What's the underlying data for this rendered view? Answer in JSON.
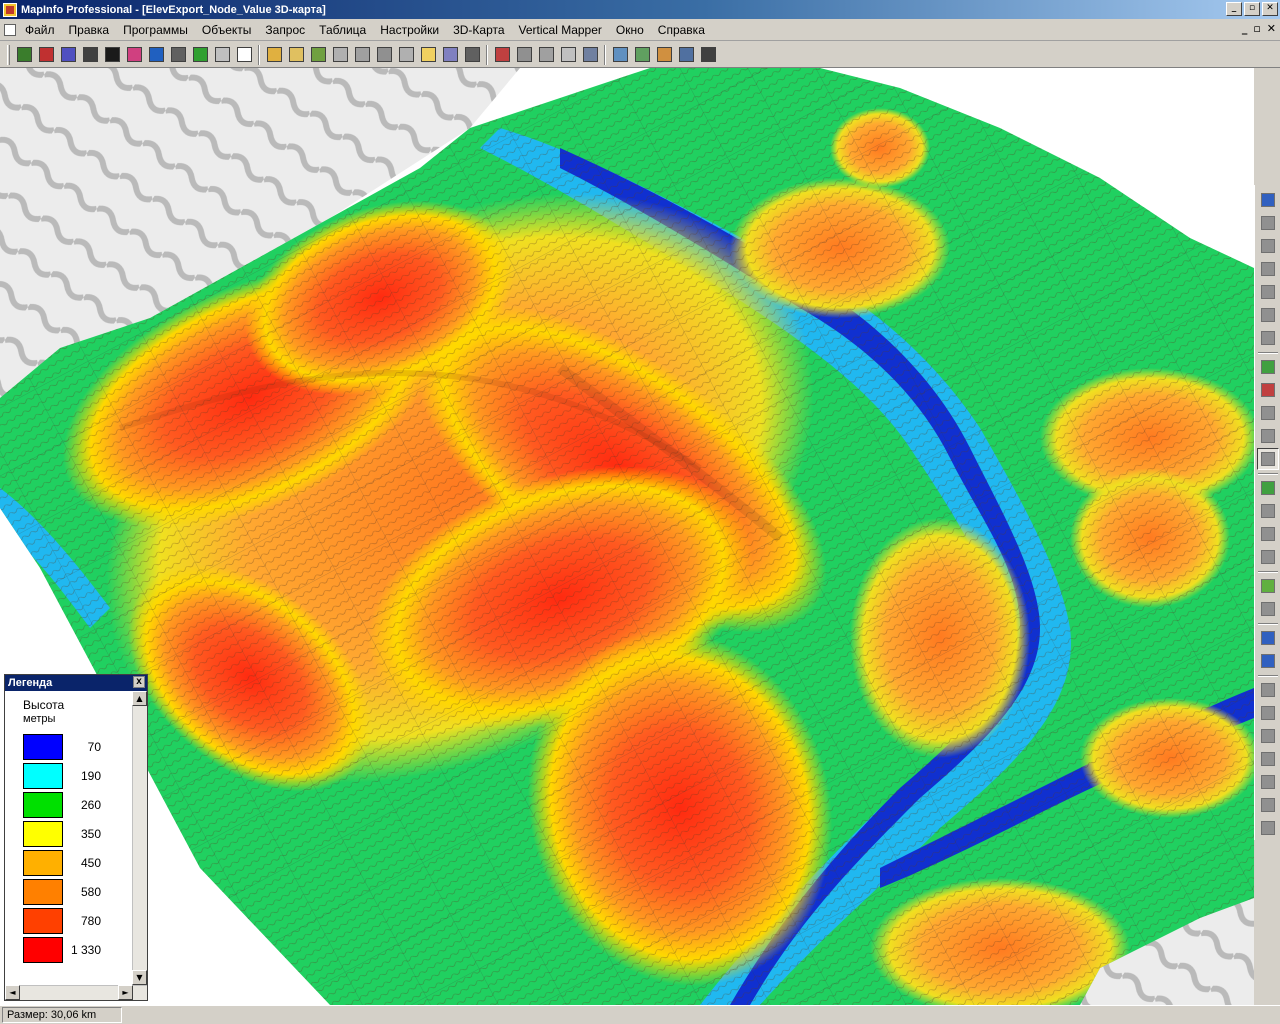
{
  "window": {
    "title": "MapInfo Professional - [ElevExport_Node_Value 3D-карта]",
    "minimize": "_",
    "maximize": "▫",
    "close": "✕"
  },
  "menu": {
    "items": [
      "Файл",
      "Правка",
      "Программы",
      "Объекты",
      "Запрос",
      "Таблица",
      "Настройки",
      "3D-Карта",
      "Vertical Mapper",
      "Окно",
      "Справка"
    ],
    "mdi_minimize": "_",
    "mdi_restore": "▫",
    "mdi_close": "✕"
  },
  "toolbar": {
    "icon_colors": [
      "#3a7d2c",
      "#c03030",
      "#5050c0",
      "#404040",
      "#1a1a1a",
      "#d04080",
      "#2060c0",
      "#606060",
      "#30a030",
      "#c0c0c0",
      "#ffffff",
      "#e0b040",
      "#e0c060",
      "#70a040",
      "#b0b0b0",
      "#a0a0a0",
      "#909090",
      "#b0b0b0",
      "#f0d060",
      "#8080c0",
      "#606060",
      "#c04040",
      "#909090",
      "#a0a0a0",
      "#c0c0c0",
      "#7080a0",
      "#6090c0",
      "#60a060",
      "#d09040",
      "#5070a0",
      "#404040"
    ]
  },
  "legend": {
    "title": "Легенда",
    "close": "x",
    "heading": "Высота",
    "units": "метры",
    "entries": [
      {
        "color": "#0000ff",
        "label": "70"
      },
      {
        "color": "#00ffff",
        "label": "190"
      },
      {
        "color": "#00e000",
        "label": "260"
      },
      {
        "color": "#ffff00",
        "label": "350"
      },
      {
        "color": "#ffb000",
        "label": "450"
      },
      {
        "color": "#ff8000",
        "label": "580"
      },
      {
        "color": "#ff4000",
        "label": "780"
      },
      {
        "color": "#ff0000",
        "label": "1 330"
      }
    ],
    "scroll_up": "▲",
    "scroll_down": "▼",
    "scroll_left": "◄",
    "scroll_right": "►"
  },
  "vtoolbar": {
    "icon_colors": [
      "#3060c0",
      "#909090",
      "#909090",
      "#909090",
      "#909090",
      "#909090",
      "#909090",
      "#40a040",
      "#c04040",
      "#909090",
      "#909090",
      "#909090",
      "#40a040",
      "#909090",
      "#909090",
      "#909090",
      "#60b040",
      "#909090",
      "#3060c0",
      "#3060c0",
      "#909090",
      "#909090",
      "#909090",
      "#909090",
      "#909090",
      "#909090",
      "#909090"
    ],
    "active_index": 11
  },
  "status": {
    "size_text": "Размер: 30,06 km"
  }
}
